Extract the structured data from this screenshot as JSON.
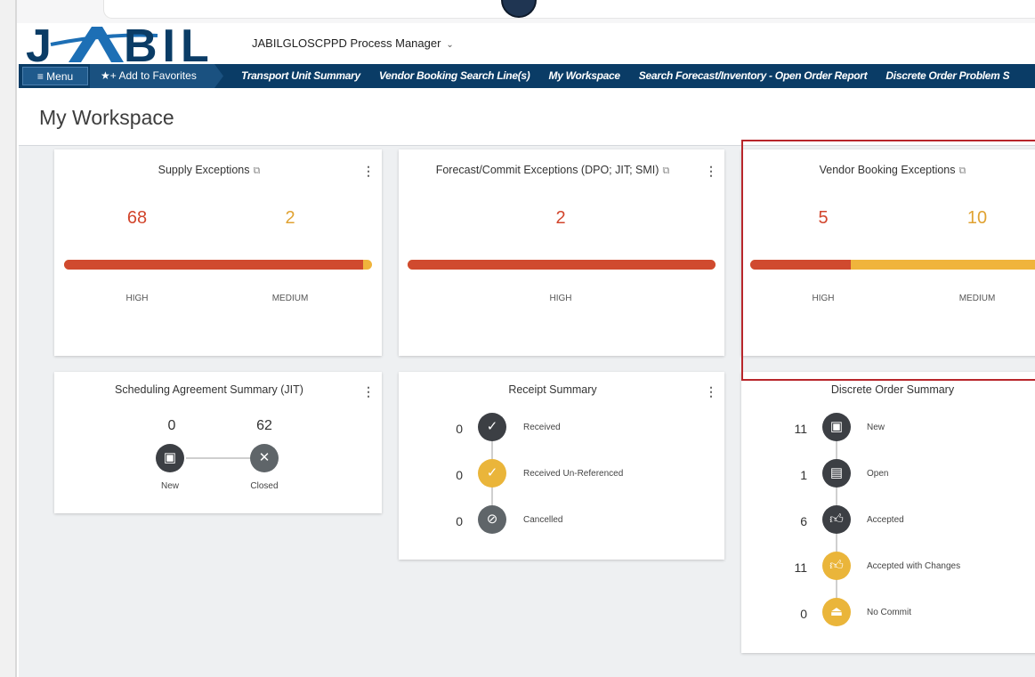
{
  "app": {
    "logo_text": "JABIL",
    "app_name": "JABILGLOSCPPD Process Manager",
    "brand_navy": "#0a3c66",
    "brand_blue": "#1d6fb5"
  },
  "nav": {
    "menu_label": "≡ Menu",
    "favorites_label": "★+ Add to Favorites",
    "links": [
      "Transport Unit Summary",
      "Vendor Booking Search Line(s)",
      "My Workspace",
      "Search Forecast/Inventory - Open Order Report",
      "Discrete Order Problem S"
    ]
  },
  "page": {
    "title": "My Workspace"
  },
  "cards": {
    "supply": {
      "title": "Supply Exceptions",
      "high_value": "68",
      "medium_value": "2",
      "high_label": "HIGH",
      "medium_label": "MEDIUM",
      "high_fraction": 0.971
    },
    "forecast": {
      "title": "Forecast/Commit Exceptions (DPO; JIT; SMI)",
      "high_value": "2",
      "high_label": "HIGH",
      "high_fraction": 1.0
    },
    "vendor": {
      "title": "Vendor Booking Exceptions",
      "high_value": "5",
      "medium_value": "10",
      "high_label": "HIGH",
      "medium_label": "MEDIUM",
      "high_fraction": 0.333
    },
    "scheduling": {
      "title": "Scheduling Agreement Summary (JIT)",
      "new_value": "0",
      "closed_value": "62",
      "new_label": "New",
      "closed_label": "Closed"
    },
    "receipt": {
      "title": "Receipt Summary",
      "rows": [
        {
          "count": "0",
          "label": "Received",
          "icon": "check-icon"
        },
        {
          "count": "0",
          "label": "Received Un-Referenced",
          "icon": "check-icon"
        },
        {
          "count": "0",
          "label": "Cancelled",
          "icon": "ban-icon"
        }
      ]
    },
    "discrete": {
      "title": "Discrete Order Summary",
      "rows": [
        {
          "count": "11",
          "label": "New",
          "icon": "new-doc-icon"
        },
        {
          "count": "1",
          "label": "Open",
          "icon": "open-doc-icon"
        },
        {
          "count": "6",
          "label": "Accepted",
          "icon": "thumbs-up-icon"
        },
        {
          "count": "11",
          "label": "Accepted with Changes",
          "icon": "thumbs-up-icon"
        },
        {
          "count": "0",
          "label": "No Commit",
          "icon": "eject-icon"
        }
      ]
    }
  }
}
